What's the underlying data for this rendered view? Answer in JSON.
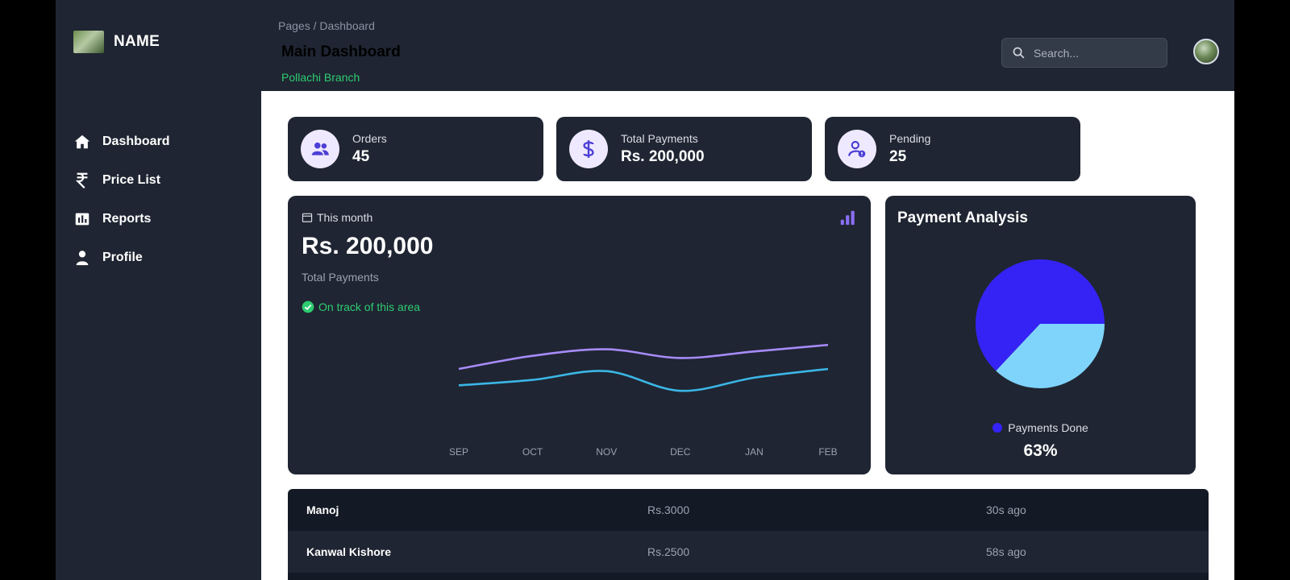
{
  "brand": {
    "name": "NAME"
  },
  "sidebar": {
    "items": [
      {
        "label": "Dashboard",
        "icon": "home-icon"
      },
      {
        "label": "Price List",
        "icon": "rupee-icon"
      },
      {
        "label": "Reports",
        "icon": "bar-chart-icon"
      },
      {
        "label": "Profile",
        "icon": "user-icon"
      }
    ]
  },
  "header": {
    "breadcrumb": "Pages / Dashboard",
    "title": "Main Dashboard",
    "subtitle": "Pollachi Branch",
    "search_placeholder": "Search..."
  },
  "stats": [
    {
      "label": "Orders",
      "value": "45",
      "icon": "users-icon"
    },
    {
      "label": "Total Payments",
      "value": "Rs. 200,000",
      "icon": "dollar-icon"
    },
    {
      "label": "Pending",
      "value": "25",
      "icon": "user-pending-icon"
    }
  ],
  "overview": {
    "period": "This month",
    "value": "Rs. 200,000",
    "label": "Total Payments",
    "status": "On track of this area"
  },
  "chart_data": {
    "type": "line",
    "categories": [
      "SEP",
      "OCT",
      "NOV",
      "DEC",
      "JAN",
      "FEB"
    ],
    "series": [
      {
        "color": "#a78bfa",
        "values": [
          70,
          82,
          88,
          80,
          86,
          92
        ]
      },
      {
        "color": "#3bb6e6",
        "values": [
          55,
          60,
          68,
          50,
          62,
          70
        ]
      }
    ],
    "ylim": [
      0,
      140
    ],
    "grid": false
  },
  "payment_analysis": {
    "title": "Payment Analysis",
    "legend": "Payments Done",
    "percent_text": "63%",
    "chart_data": {
      "type": "pie",
      "slices": [
        {
          "value": 63,
          "color": "#3523f5"
        },
        {
          "value": 37,
          "color": "#7fd4fb"
        }
      ]
    }
  },
  "transactions": [
    {
      "name": "Manoj",
      "amount": "Rs.3000",
      "time": "30s ago"
    },
    {
      "name": "Kanwal Kishore",
      "amount": "Rs.2500",
      "time": "58s ago"
    }
  ]
}
